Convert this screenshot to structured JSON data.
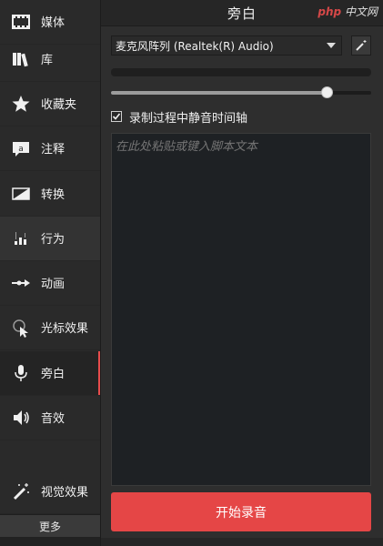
{
  "sidebar": {
    "items": [
      {
        "label": "媒体",
        "icon": "film-strip-icon"
      },
      {
        "label": "库",
        "icon": "library-books-icon"
      },
      {
        "label": "收藏夹",
        "icon": "star-icon"
      },
      {
        "label": "注释",
        "icon": "annotation-bubble-icon"
      },
      {
        "label": "转换",
        "icon": "transition-icon"
      },
      {
        "label": "行为",
        "icon": "behavior-icon"
      },
      {
        "label": "动画",
        "icon": "animation-arrow-icon"
      },
      {
        "label": "光标效果",
        "icon": "cursor-effect-icon"
      },
      {
        "label": "旁白",
        "icon": "microphone-icon"
      },
      {
        "label": "音效",
        "icon": "speaker-icon"
      },
      {
        "label": "视觉效果",
        "icon": "magic-wand-icon"
      }
    ],
    "active": "旁白",
    "more_label": "更多"
  },
  "panel": {
    "title": "旁白",
    "device": "麦克风阵列 (Realtek(R) Audio)",
    "volume_level": 0.83,
    "mute_checkbox_label": "录制过程中静音时间轴",
    "mute_checked": true,
    "script_placeholder": "在此处粘贴或键入脚本文本",
    "record_button": "开始录音"
  },
  "watermark": {
    "brand": "php",
    "text": "中文网"
  },
  "colors": {
    "accent": "#e54646",
    "background": "#2e2e2e",
    "sidebar": "#2a2a2a"
  }
}
